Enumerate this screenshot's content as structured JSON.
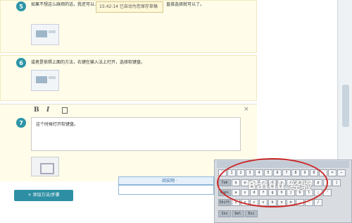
{
  "steps": [
    {
      "number": "5",
      "text": "如果不想这么麻烦的话，我还可以……就可以把数学符号调到输入法里。直接选择就可以了。"
    },
    {
      "number": "6",
      "text": "或者是依照上面的方法，右键在输入法上打开，选择软键盘。"
    }
  ],
  "tooltip": {
    "text": "15:42:14 已自动为您保存草稿"
  },
  "editor": {
    "number": "7",
    "bold_label": "B",
    "italic_label": "I",
    "content": "这个时候打开软键盘。",
    "close_label": "×"
  },
  "add_step_label": "+ 添加方法/步骤",
  "ime": {
    "label": "阅安网 ·"
  },
  "keyboard": {
    "watermark": "Baidu 经验",
    "rows": [
      [
        "`",
        "1",
        "2",
        "3",
        "4",
        "5",
        "6",
        "7",
        "8",
        "9",
        "0",
        "-",
        "=",
        "←"
      ],
      [
        "Tab",
        "q",
        "w",
        "e",
        "r",
        "t",
        "y",
        "u",
        "i",
        "o",
        "p",
        "[",
        "]"
      ],
      [
        "Caps",
        "a",
        "s",
        "d",
        "f",
        "g",
        "h",
        "j",
        "k",
        "l",
        ";",
        "'"
      ],
      [
        "Shift",
        "z",
        "x",
        "c",
        "v",
        "b",
        "n",
        "m",
        ",",
        ".",
        "/"
      ],
      [
        "Ins",
        "Del",
        "Esc"
      ]
    ]
  },
  "colors": {
    "accent": "#2e8fa4",
    "annotation": "#cc2b2b"
  }
}
